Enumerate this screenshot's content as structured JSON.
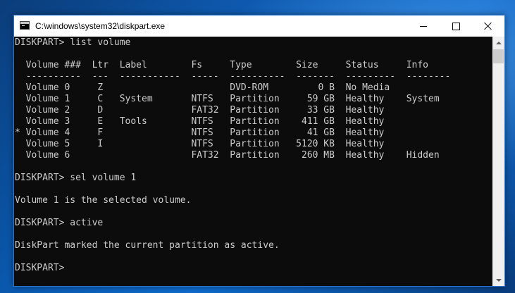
{
  "window": {
    "title": "C:\\windows\\system32\\diskpart.exe",
    "icon": "console-app-icon",
    "controls": [
      "minimize-icon",
      "maximize-icon",
      "close-icon"
    ]
  },
  "console": {
    "prompt_cmd_1": "DISKPART> list volume",
    "blank_1": "",
    "header_row": "  Volume ###  Ltr  Label        Fs     Type        Size     Status     Info",
    "separator_row": "  ----------  ---  -----------  -----  ----------  -------  ---------  --------",
    "volumes": [
      "  Volume 0     Z                       DVD-ROM         0 B  No Media",
      "  Volume 1     C   System       NTFS   Partition     59 GB  Healthy    System",
      "  Volume 2     D                FAT32  Partition     33 GB  Healthy",
      "  Volume 3     E   Tools        NTFS   Partition    411 GB  Healthy",
      "* Volume 4     F                NTFS   Partition     41 GB  Healthy",
      "  Volume 5     I                NTFS   Partition   5120 KB  Healthy",
      "  Volume 6                      FAT32  Partition    260 MB  Healthy    Hidden"
    ],
    "blank_2": "",
    "prompt_cmd_2": "DISKPART> sel volume 1",
    "blank_3": "",
    "msg_selected": "Volume 1 is the selected volume.",
    "blank_4": "",
    "prompt_cmd_3": "DISKPART> active",
    "blank_5": "",
    "msg_active": "DiskPart marked the current partition as active.",
    "blank_6": "",
    "prompt_final": "DISKPART>"
  },
  "colors": {
    "console_bg": "#0c0c0c",
    "console_text": "#cccccc",
    "titlebar_bg": "#ffffff",
    "window_border": "#2b79d6"
  }
}
